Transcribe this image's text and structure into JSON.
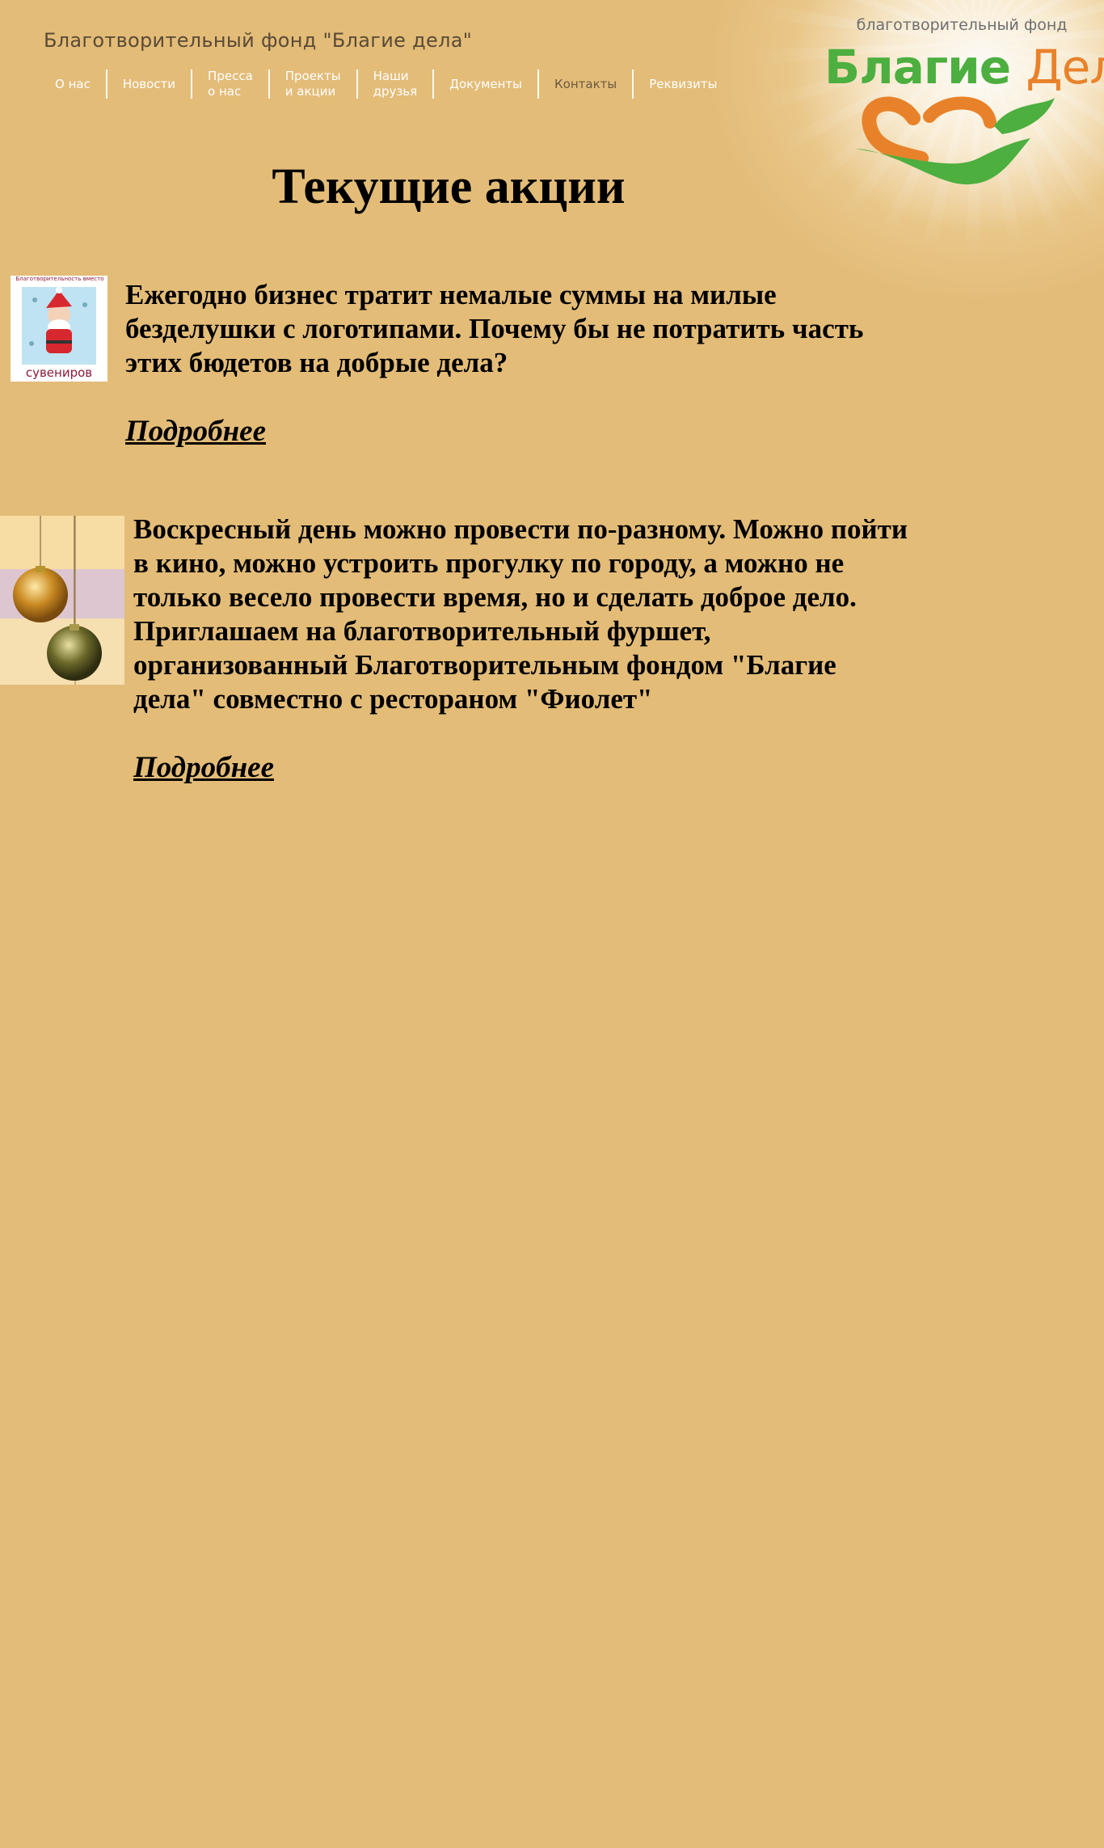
{
  "header": {
    "site_title": "Благотворительный фонд \"Благие дела\"",
    "nav": [
      {
        "line1": "О нас",
        "line2": ""
      },
      {
        "line1": "Новости",
        "line2": ""
      },
      {
        "line1": "Пресса",
        "line2": "о нас"
      },
      {
        "line1": "Проекты",
        "line2": "и акции"
      },
      {
        "line1": "Наши",
        "line2": "друзья"
      },
      {
        "line1": "Документы",
        "line2": ""
      },
      {
        "line1": "Контакты",
        "line2": ""
      },
      {
        "line1": "Реквизиты",
        "line2": ""
      }
    ]
  },
  "logo": {
    "caption": "благотворительный фонд",
    "word1": "Благие",
    "word2": "Дела",
    "color_green": "#4caf3f",
    "color_orange": "#e8822a"
  },
  "main": {
    "title": "Текущие акции",
    "promos": [
      {
        "image_icon": "souvenir-santa-icon",
        "image_text_top": "Благотворительность вместо",
        "image_text_bottom": "сувениров",
        "text": "Ежегодно бизнес тратит немалые суммы на милые безделушки с логотипами. Почему бы не потратить часть этих бюдетов на добрые дела?",
        "link": "Подробнее"
      },
      {
        "image_icon": "christmas-ornaments-icon",
        "text": "Воскресный день можно провести по-разному. Можно пойти в кино, можно устроить прогулку по городу, а можно не только весело провести время, но и сделать доброе дело. Приглашаем на благотворительный фуршет, организованный Благотворительным фондом \"Благие дела\" совместно с рестораном \"Фиолет\"",
        "link": "Подробнее"
      }
    ]
  },
  "colors": {
    "background": "#e3bc78",
    "nav_text": "#ffffff",
    "title_text": "#000000"
  }
}
